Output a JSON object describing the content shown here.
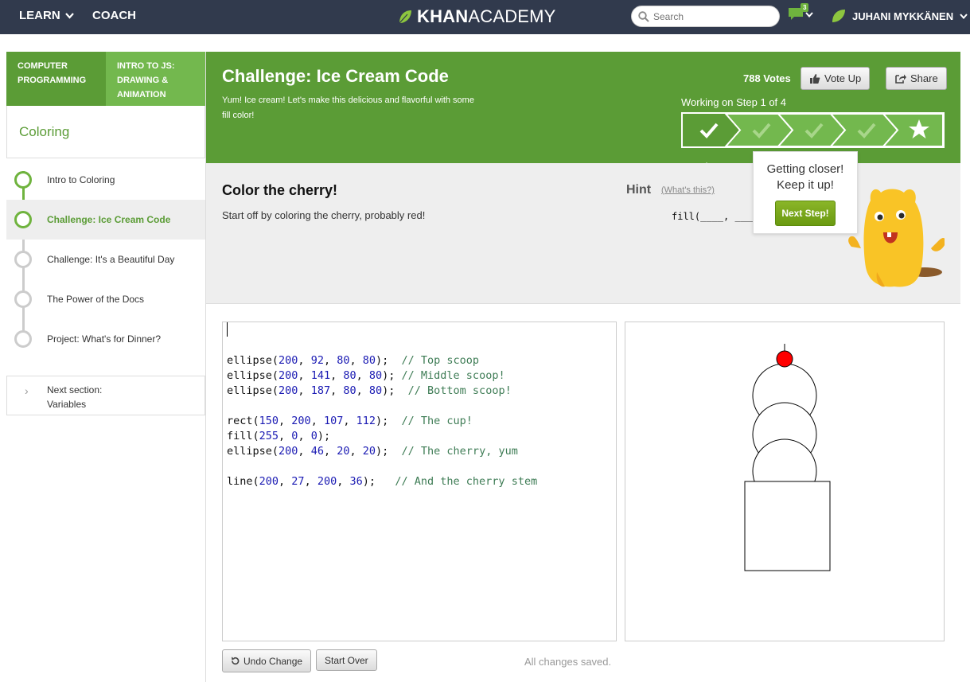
{
  "nav": {
    "learn": "LEARN",
    "coach": "COACH",
    "logo_bold": "KHAN",
    "logo_rest": "ACADEMY",
    "search_placeholder": "Search",
    "notifications_count": "3",
    "user_name": "JUHANI MYKKÄNEN"
  },
  "sidebar": {
    "crumb_1": "COMPUTER PROGRAMMING",
    "crumb_2": "INTRO TO JS: DRAWING & ANIMATION",
    "section_title": "Coloring",
    "lessons": [
      {
        "label": "Intro to Coloring"
      },
      {
        "label": "Challenge: Ice Cream Code"
      },
      {
        "label": "Challenge: It's a Beautiful Day"
      },
      {
        "label": "The Power of the Docs"
      },
      {
        "label": "Project: What's for Dinner?"
      }
    ],
    "next_section_label": "Next section:",
    "next_section_name": "Variables"
  },
  "challenge": {
    "title": "Challenge: Ice Cream Code",
    "description": "Yum! Ice cream! Let's make this delicious and flavorful with some fill color!",
    "votes": "788 Votes",
    "vote_up": "Vote Up",
    "share": "Share",
    "step_label": "Working on Step 1 of 4",
    "current_step": 1,
    "total_steps": 4
  },
  "instructions": {
    "title": "Color the cherry!",
    "text": "Start off by coloring the cherry, probably red!",
    "hint_title": "Hint",
    "hint_link": "(What's this?)",
    "hint_code": "fill(____, ____"
  },
  "tooltip": {
    "line1": "Getting closer!",
    "line2": "Keep it up!",
    "button": "Next Step!"
  },
  "code": [
    [],
    [
      [
        "ellipse(",
        "t"
      ],
      [
        "200",
        "n"
      ],
      [
        ", ",
        "t"
      ],
      [
        "92",
        "n"
      ],
      [
        ", ",
        "t"
      ],
      [
        "80",
        "n"
      ],
      [
        ", ",
        "t"
      ],
      [
        "80",
        "n"
      ],
      [
        ");  ",
        "t"
      ],
      [
        "// Top scoop",
        "c"
      ]
    ],
    [
      [
        "ellipse(",
        "t"
      ],
      [
        "200",
        "n"
      ],
      [
        ", ",
        "t"
      ],
      [
        "141",
        "n"
      ],
      [
        ", ",
        "t"
      ],
      [
        "80",
        "n"
      ],
      [
        ", ",
        "t"
      ],
      [
        "80",
        "n"
      ],
      [
        "); ",
        "t"
      ],
      [
        "// Middle scoop!",
        "c"
      ]
    ],
    [
      [
        "ellipse(",
        "t"
      ],
      [
        "200",
        "n"
      ],
      [
        ", ",
        "t"
      ],
      [
        "187",
        "n"
      ],
      [
        ", ",
        "t"
      ],
      [
        "80",
        "n"
      ],
      [
        ", ",
        "t"
      ],
      [
        "80",
        "n"
      ],
      [
        ");  ",
        "t"
      ],
      [
        "// Bottom scoop!",
        "c"
      ]
    ],
    [],
    [
      [
        "rect(",
        "t"
      ],
      [
        "150",
        "n"
      ],
      [
        ", ",
        "t"
      ],
      [
        "200",
        "n"
      ],
      [
        ", ",
        "t"
      ],
      [
        "107",
        "n"
      ],
      [
        ", ",
        "t"
      ],
      [
        "112",
        "n"
      ],
      [
        ");  ",
        "t"
      ],
      [
        "// The cup!",
        "c"
      ]
    ],
    [
      [
        "fill(",
        "t"
      ],
      [
        "255",
        "n"
      ],
      [
        ", ",
        "t"
      ],
      [
        "0",
        "n"
      ],
      [
        ", ",
        "t"
      ],
      [
        "0",
        "n"
      ],
      [
        ");",
        "t"
      ]
    ],
    [
      [
        "ellipse(",
        "t"
      ],
      [
        "200",
        "n"
      ],
      [
        ", ",
        "t"
      ],
      [
        "46",
        "n"
      ],
      [
        ", ",
        "t"
      ],
      [
        "20",
        "n"
      ],
      [
        ", ",
        "t"
      ],
      [
        "20",
        "n"
      ],
      [
        ");  ",
        "t"
      ],
      [
        "// The cherry, yum",
        "c"
      ]
    ],
    [],
    [
      [
        "line(",
        "t"
      ],
      [
        "200",
        "n"
      ],
      [
        ", ",
        "t"
      ],
      [
        "27",
        "n"
      ],
      [
        ", ",
        "t"
      ],
      [
        "200",
        "n"
      ],
      [
        ", ",
        "t"
      ],
      [
        "36",
        "n"
      ],
      [
        ");   ",
        "t"
      ],
      [
        "// And the cherry stem",
        "c"
      ]
    ]
  ],
  "editor_actions": {
    "undo": "Undo Change",
    "start_over": "Start Over",
    "status": "All changes saved."
  },
  "colors": {
    "nav_bg": "#313a4d",
    "brand_green": "#5b9c36",
    "light_green": "#73b84e",
    "cherry_red": "#ff0000"
  }
}
